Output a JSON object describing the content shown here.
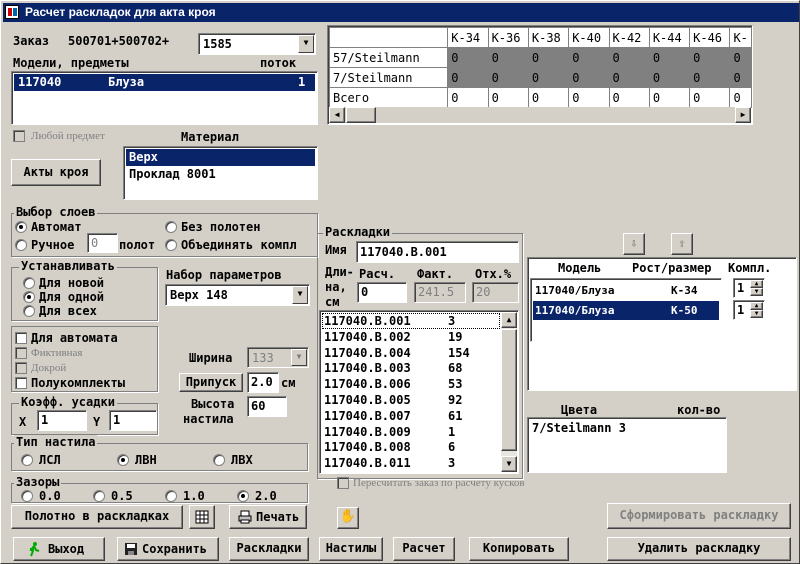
{
  "window": {
    "title": "Расчет раскладок для акта кроя"
  },
  "order": {
    "label": "Заказ",
    "prefix": "500701+500702+",
    "value": "1585"
  },
  "models": {
    "header_models": "Модели, предметы",
    "header_flow": "поток",
    "rows": [
      {
        "code": "117040",
        "name": "Блуза",
        "flow": "1"
      }
    ]
  },
  "any_item": {
    "label": "Любой предмет"
  },
  "material": {
    "label": "Материал",
    "items": [
      "Верх",
      "Проклад 8001"
    ]
  },
  "acts_button": "Акты кроя",
  "size_grid": {
    "columns": [
      "К-34",
      "К-36",
      "К-38",
      "К-40",
      "К-42",
      "К-44",
      "К-46",
      "К-"
    ],
    "rows": [
      {
        "label": "57/Steilmann",
        "values": [
          "0",
          "0",
          "0",
          "0",
          "0",
          "0",
          "0",
          "0"
        ]
      },
      {
        "label": "7/Steilmann",
        "values": [
          "0",
          "0",
          "0",
          "0",
          "0",
          "0",
          "0",
          "0"
        ]
      },
      {
        "label": "Всего",
        "values": [
          "0",
          "0",
          "0",
          "0",
          "0",
          "0",
          "0",
          "0"
        ]
      }
    ]
  },
  "layer_choice": {
    "title": "Выбор слоев",
    "auto": "Автомат",
    "manual": "Ручное",
    "manual_value": "0",
    "manual_suffix": "полот",
    "no_cloth": "Без полотен",
    "combine": "Объединять компл"
  },
  "install": {
    "title": "Устанавливать",
    "opts": [
      "Для новой",
      "Для одной",
      "Для всех"
    ]
  },
  "param_set": {
    "label": "Набор параметров",
    "value": "Верх 148"
  },
  "flags": {
    "auto": "Для автомата",
    "fictive": "Фиктивная",
    "doubler": "Докрой",
    "semi": "Полукомплекты"
  },
  "width": {
    "label": "Ширина",
    "value": "133"
  },
  "allowance": {
    "label": "Припуск",
    "value": "2.0",
    "unit": "см"
  },
  "height": {
    "label1": "Высота",
    "label2": "настила",
    "value": "60"
  },
  "shrink": {
    "title": "Коэфф. усадки",
    "x_label": "X",
    "x_value": "1",
    "y_label": "Y",
    "y_value": "1"
  },
  "spread_type": {
    "title": "Тип настила",
    "opts": [
      "ЛСЛ",
      "ЛВН",
      "ЛВХ"
    ]
  },
  "gaps": {
    "title": "Зазоры",
    "opts": [
      "0.0",
      "0.5",
      "1.0",
      "2.0"
    ]
  },
  "layouts": {
    "title": "Раскладки",
    "name_label": "Имя",
    "name_value": "117040.В.001",
    "len_label1": "Дли-",
    "len_label2": "на,",
    "len_label3": "см",
    "calc_label": "Расч.",
    "fact_label": "Факт.",
    "dev_label": "Отх.%",
    "calc_value": "0",
    "fact_value": "241.5",
    "dev_value": "20",
    "list": [
      {
        "name": "117040.В.001",
        "count": "3"
      },
      {
        "name": "117040.В.002",
        "count": "19"
      },
      {
        "name": "117040.В.004",
        "count": "154"
      },
      {
        "name": "117040.В.003",
        "count": "68"
      },
      {
        "name": "117040.В.006",
        "count": "53"
      },
      {
        "name": "117040.В.005",
        "count": "92"
      },
      {
        "name": "117040.В.007",
        "count": "61"
      },
      {
        "name": "117040.В.009",
        "count": "1"
      },
      {
        "name": "117040.В.008",
        "count": "6"
      },
      {
        "name": "117040.В.011",
        "count": "3"
      }
    ]
  },
  "recalc": {
    "label": "Пересчитать заказ по расчету кусков"
  },
  "layout_models": {
    "h_model": "Модель",
    "h_size": "Рост/размер",
    "h_kompl": "Компл.",
    "rows": [
      {
        "model": "117040/Блуза",
        "size": "К-34",
        "kompl": "1"
      },
      {
        "model": "117040/Блуза",
        "size": "К-50",
        "kompl": "1"
      }
    ]
  },
  "colors": {
    "h_color": "Цвета",
    "h_qty": "кол-во",
    "rows": [
      {
        "text": "7/Steilmann 3"
      }
    ]
  },
  "buttons": {
    "cloth_in_layouts": "Полотно в раскладках",
    "print": "Печать",
    "form_layout": "Сформировать раскладку",
    "exit": "Выход",
    "save": "Сохранить",
    "layouts": "Раскладки",
    "spreads": "Настилы",
    "calc": "Расчет",
    "copy": "Копировать",
    "delete_layout": "Удалить раскладку"
  },
  "colors_theme": {
    "title_bg": "#0a246a",
    "face": "#d4d0c8",
    "selected": "#0a246a"
  }
}
